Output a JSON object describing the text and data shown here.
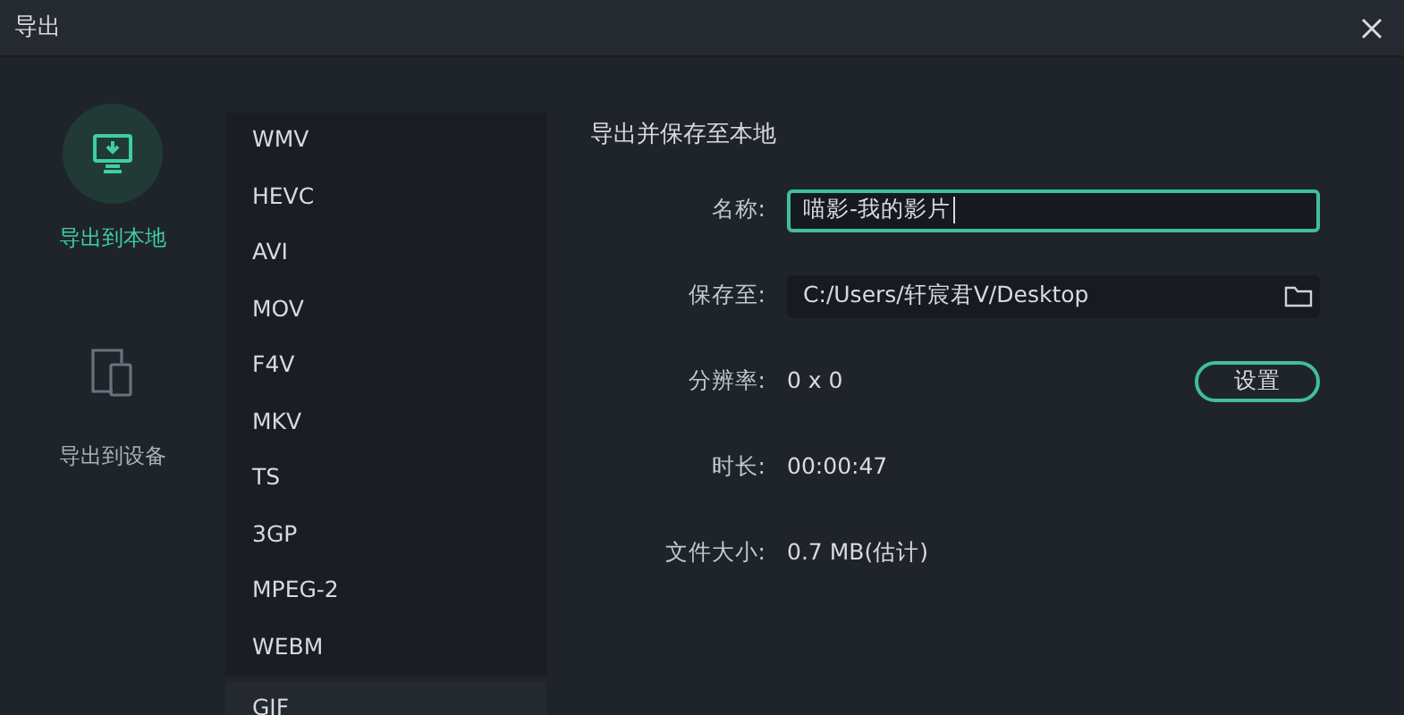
{
  "window": {
    "title": "导出"
  },
  "nav": [
    {
      "kind": "local",
      "label": "导出到本地",
      "selected": true
    },
    {
      "kind": "device",
      "label": "导出到设备",
      "selected": false
    }
  ],
  "formats": [
    {
      "label": "WMV",
      "selected": false
    },
    {
      "label": "HEVC",
      "selected": false
    },
    {
      "label": "AVI",
      "selected": false
    },
    {
      "label": "MOV",
      "selected": false
    },
    {
      "label": "F4V",
      "selected": false
    },
    {
      "label": "MKV",
      "selected": false
    },
    {
      "label": "TS",
      "selected": false
    },
    {
      "label": "3GP",
      "selected": false
    },
    {
      "label": "MPEG-2",
      "selected": false
    },
    {
      "label": "WEBM",
      "selected": false
    },
    {
      "label": "GIF",
      "selected": true
    }
  ],
  "panel": {
    "title": "导出并保存至本地",
    "fields": [
      {
        "kind": "input",
        "label": "名称:",
        "value": "喵影-我的影片"
      },
      {
        "kind": "path",
        "label": "保存至:",
        "value": "C:/Users/轩宸君V/Desktop"
      },
      {
        "kind": "setting",
        "label": "分辨率:",
        "value": "0 x 0",
        "button": "设置"
      },
      {
        "kind": "text",
        "label": "时长:",
        "value": "00:00:47"
      },
      {
        "kind": "text",
        "label": "文件大小:",
        "value": "0.7 MB(估计)"
      }
    ]
  }
}
